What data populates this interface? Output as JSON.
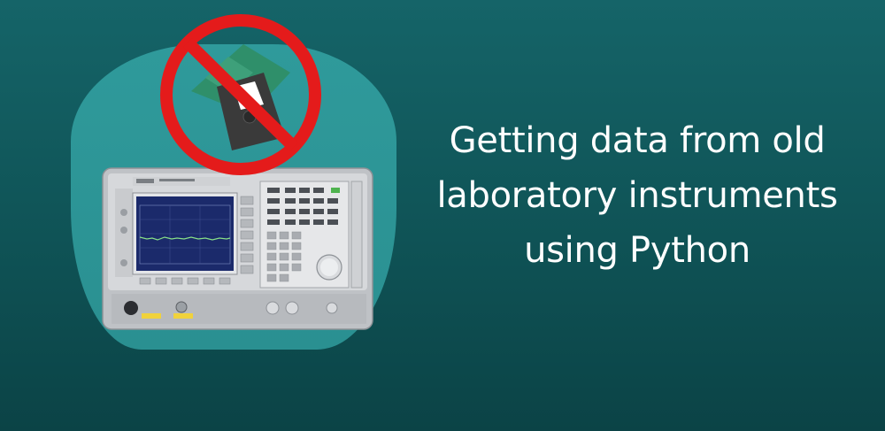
{
  "headline": {
    "line1": "Getting data from old",
    "line2": "laboratory instruments",
    "line3": "using Python"
  },
  "colors": {
    "background": "#0f5356",
    "blob": "#2c9596",
    "prohibition": "#e41b1b",
    "floppy_green": "#2f8f6a",
    "floppy_dark": "#3a3a3a",
    "instrument_gray": "#c7c9cc",
    "screen_blue": "#1b2a6b",
    "trace_green": "#88e088"
  },
  "icons": {
    "no_sign": "prohibition-icon",
    "floppy": "floppy-disk-icon",
    "instrument": "spectrum-analyzer-image"
  }
}
